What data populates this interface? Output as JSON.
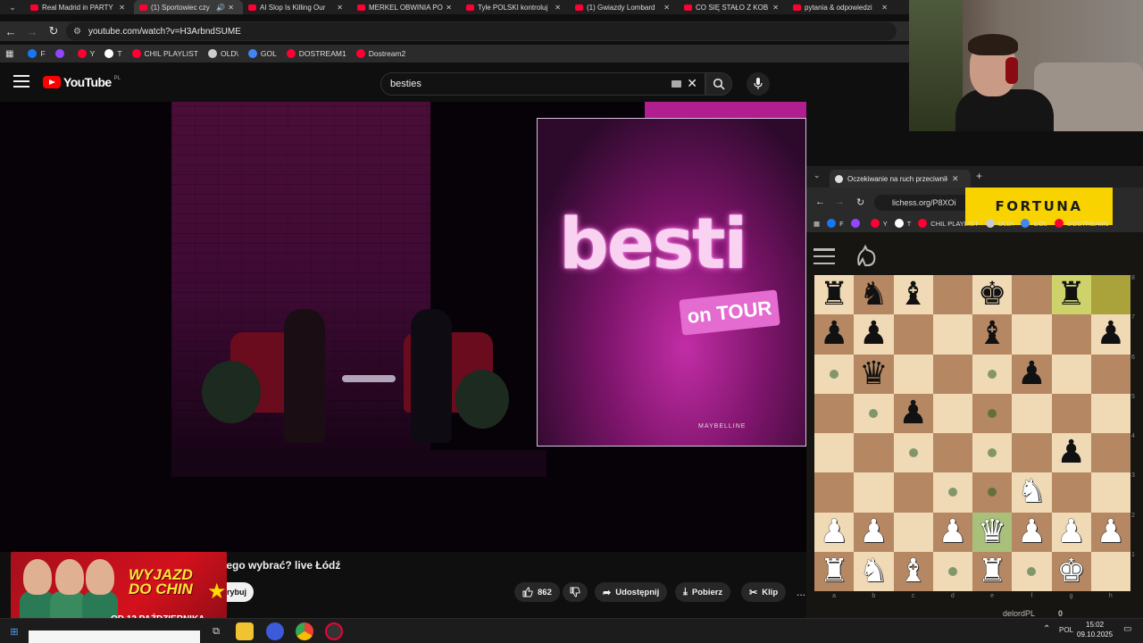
{
  "browser": {
    "tabs": [
      {
        "title": "Real Madrid in PARTY"
      },
      {
        "title": "(1) Sportowiec czy"
      },
      {
        "title": "AI Slop Is Killing Our"
      },
      {
        "title": "MERKEL OBWINIA PO"
      },
      {
        "title": "Tyle POLSKI kontroluj"
      },
      {
        "title": "(1) Gwiazdy Lombard"
      },
      {
        "title": "CO SIĘ STAŁO Z KOB"
      },
      {
        "title": "pytania & odpowiedzi"
      }
    ],
    "url": "youtube.com/watch?v=H3ArbndSUME",
    "bookmarks": [
      {
        "label": "F"
      },
      {
        "label": ""
      },
      {
        "label": "Y"
      },
      {
        "label": "T"
      },
      {
        "label": "CHIL PLAYLIST"
      },
      {
        "label": "OLD\\"
      },
      {
        "label": "GOL"
      },
      {
        "label": "DOSTREAM1"
      },
      {
        "label": "Dostream2"
      }
    ]
  },
  "youtube": {
    "logo_text": "YouTube",
    "country": "PL",
    "search_value": "besties",
    "video_title": "Sportowiec czy student, którego wybrać? live Łódź",
    "video_screen_text": "besti",
    "video_tour_text": "on TOUR",
    "video_sponsor": "MAYBELLINE",
    "subscribe_label": "Subskrybuj",
    "likes": "862",
    "share_label": "Udostępnij",
    "download_label": "Pobierz",
    "clip_label": "Klip",
    "more_label": "..."
  },
  "promo": {
    "title_line1": "WYJAZD",
    "title_line2": "DO CHIN",
    "date": "OD 13 PAŹDZIERNIKA"
  },
  "lichess": {
    "tab_title": "Oczekiwanie na ruch przeciwnik",
    "url": "lichess.org/P8XOi",
    "fortuna": "FORTUNA",
    "bookmarks": [
      "F",
      "",
      "Y",
      "T",
      "CHIL PLAYLIST",
      "OLD\\",
      "GOL",
      "DOSTREAM1"
    ],
    "board": [
      [
        "r",
        "n",
        "b",
        "",
        "k",
        "",
        "r",
        ""
      ],
      [
        "p",
        "p",
        "",
        "",
        "b",
        "",
        "",
        "p"
      ],
      [
        "",
        "q",
        "",
        "",
        "",
        "p",
        "",
        ""
      ],
      [
        "",
        "",
        "p",
        "",
        "",
        "",
        "",
        ""
      ],
      [
        "",
        "",
        "",
        "",
        "",
        "",
        "p",
        ""
      ],
      [
        "",
        "",
        "",
        "",
        "",
        "N",
        "",
        ""
      ],
      [
        "P",
        "P",
        "",
        "P",
        "Q",
        "P",
        "P",
        "P"
      ],
      [
        "R",
        "N",
        "B",
        "",
        "R",
        "",
        "K",
        ""
      ]
    ],
    "highlights": [
      [
        0,
        6
      ],
      [
        0,
        7
      ]
    ],
    "move_dots": [
      [
        2,
        0
      ],
      [
        2,
        4
      ],
      [
        3,
        1
      ],
      [
        3,
        4
      ],
      [
        4,
        2
      ],
      [
        4,
        4
      ],
      [
        5,
        3
      ],
      [
        5,
        4
      ],
      [
        7,
        3
      ],
      [
        7,
        5
      ]
    ],
    "files": [
      "a",
      "b",
      "c",
      "d",
      "e",
      "f",
      "g",
      "h"
    ],
    "ranks": [
      "8",
      "7",
      "6",
      "5",
      "4",
      "3",
      "2",
      "1"
    ],
    "opponent": "delordPL",
    "opponent_score": "0"
  },
  "taskbar": {
    "language": "POL",
    "time": "15:02",
    "date": "09.10.2025"
  }
}
